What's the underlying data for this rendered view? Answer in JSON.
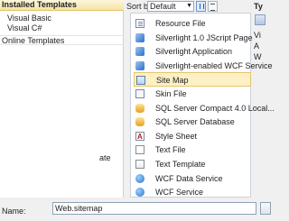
{
  "left": {
    "installed_label": "Installed Templates",
    "tree": [
      "Visual Basic",
      "Visual C#"
    ],
    "online_label": "Online Templates",
    "stub_text": "ate"
  },
  "toolbar": {
    "sort_label": "Sort by:",
    "sort_value": "Default"
  },
  "list": [
    {
      "label": "Resource File",
      "icon": "resource-file-icon"
    },
    {
      "label": "Silverlight 1.0 JScript Page",
      "icon": "silverlight-icon"
    },
    {
      "label": "Silverlight Application",
      "icon": "silverlight-icon"
    },
    {
      "label": "Silverlight-enabled WCF Service",
      "icon": "silverlight-icon"
    },
    {
      "label": "Site Map",
      "icon": "site-map-icon"
    },
    {
      "label": "Skin File",
      "icon": "skin-file-icon"
    },
    {
      "label": "SQL Server Compact 4.0 Local...",
      "icon": "database-icon"
    },
    {
      "label": "SQL Server Database",
      "icon": "database-icon"
    },
    {
      "label": "Style Sheet",
      "icon": "style-sheet-icon"
    },
    {
      "label": "Text File",
      "icon": "text-file-icon"
    },
    {
      "label": "Text Template",
      "icon": "text-template-icon"
    },
    {
      "label": "WCF Data Service",
      "icon": "wcf-icon"
    },
    {
      "label": "WCF Service",
      "icon": "wcf-icon"
    }
  ],
  "selected_index": 4,
  "name_field": {
    "label": "Name:",
    "value": "Web.sitemap"
  },
  "right": {
    "head": "Ty",
    "text1": "Vi",
    "text2": "A",
    "text3": "W"
  }
}
